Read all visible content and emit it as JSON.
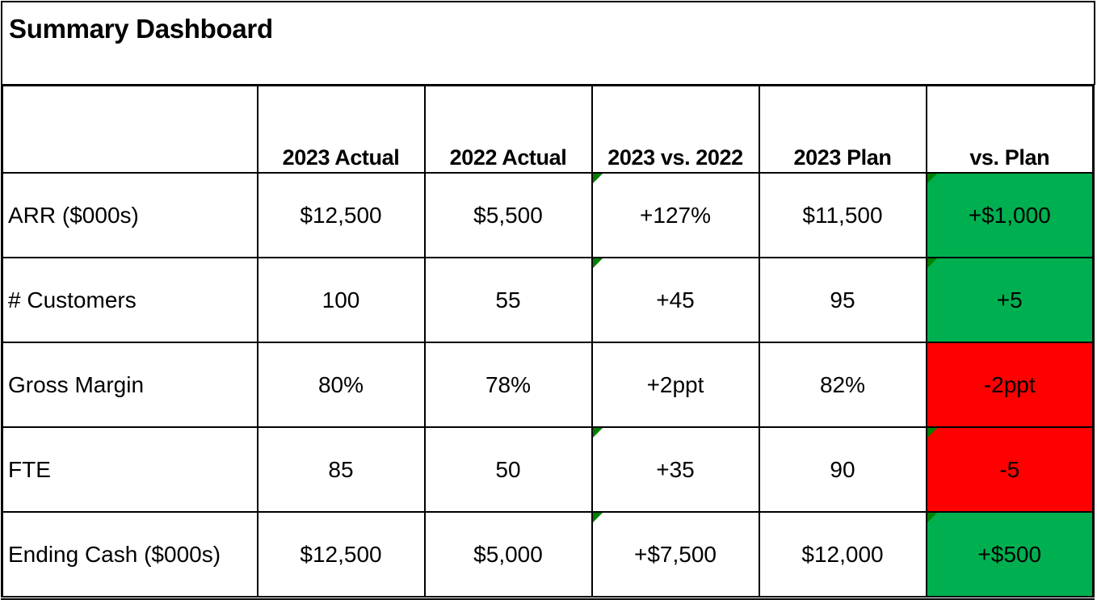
{
  "title": "Summary Dashboard",
  "colors": {
    "favorable": "#00B050",
    "unfavorable": "#FF0000",
    "error_indicator": "#008000"
  },
  "columns": [
    "",
    "2023 Actual",
    "2022 Actual",
    "2023 vs. 2022",
    "2023 Plan",
    "vs. Plan"
  ],
  "rows": [
    {
      "label": "ARR ($000s)",
      "actual_2023": "$12,500",
      "actual_2022": "$5,500",
      "yoy": "+127%",
      "plan_2023": "$11,500",
      "vs_plan": "+$1,000",
      "vs_plan_status": "favorable"
    },
    {
      "label": "# Customers",
      "actual_2023": "100",
      "actual_2022": "55",
      "yoy": "+45",
      "plan_2023": "95",
      "vs_plan": "+5",
      "vs_plan_status": "favorable"
    },
    {
      "label": "Gross Margin",
      "actual_2023": "80%",
      "actual_2022": "78%",
      "yoy": "+2ppt",
      "plan_2023": "82%",
      "vs_plan": "-2ppt",
      "vs_plan_status": "unfavorable"
    },
    {
      "label": "FTE",
      "actual_2023": "85",
      "actual_2022": "50",
      "yoy": "+35",
      "plan_2023": "90",
      "vs_plan": "-5",
      "vs_plan_status": "unfavorable"
    },
    {
      "label": "Ending Cash ($000s)",
      "actual_2023": "$12,500",
      "actual_2022": "$5,000",
      "yoy": "+$7,500",
      "plan_2023": "$12,000",
      "vs_plan": "+$500",
      "vs_plan_status": "favorable"
    }
  ]
}
